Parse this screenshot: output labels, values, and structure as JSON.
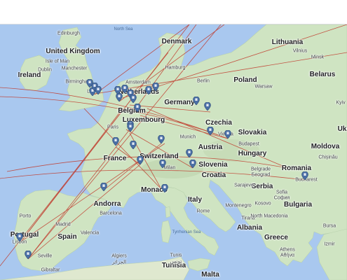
{
  "map": {
    "colors": {
      "sea": "#a9c8ef",
      "land": "#cfe4c2",
      "route": "#c0392b",
      "marker": "#4a6fa5"
    },
    "countries": [
      {
        "name": "United Kingdom",
        "id": "uk"
      },
      {
        "name": "Ireland",
        "id": "ireland"
      },
      {
        "name": "Denmark",
        "id": "denmark"
      },
      {
        "name": "Lithuania",
        "id": "lithuania"
      },
      {
        "name": "Belarus",
        "id": "belarus"
      },
      {
        "name": "Netherlands",
        "id": "netherlands"
      },
      {
        "name": "Belgium",
        "id": "belgium"
      },
      {
        "name": "Luxembourg",
        "id": "luxembourg"
      },
      {
        "name": "Germany",
        "id": "germany"
      },
      {
        "name": "Poland",
        "id": "poland"
      },
      {
        "name": "Czechia",
        "id": "czechia"
      },
      {
        "name": "Slovakia",
        "id": "slovakia"
      },
      {
        "name": "Austria",
        "id": "austria"
      },
      {
        "name": "Hungary",
        "id": "hungary"
      },
      {
        "name": "Moldova",
        "id": "moldova"
      },
      {
        "name": "France",
        "id": "france"
      },
      {
        "name": "Switzerland",
        "id": "switzerland"
      },
      {
        "name": "Slovenia",
        "id": "slovenia"
      },
      {
        "name": "Croatia",
        "id": "croatia"
      },
      {
        "name": "Romania",
        "id": "romania"
      },
      {
        "name": "Serbia",
        "id": "serbia"
      },
      {
        "name": "Bulgaria",
        "id": "bulgaria"
      },
      {
        "name": "Italy",
        "id": "italy"
      },
      {
        "name": "Monaco",
        "id": "monaco"
      },
      {
        "name": "Andorra",
        "id": "andorra"
      },
      {
        "name": "Spain",
        "id": "spain"
      },
      {
        "name": "Portugal",
        "id": "portugal"
      },
      {
        "name": "Greece",
        "id": "greece"
      },
      {
        "name": "Albania",
        "id": "albania"
      },
      {
        "name": "Tunisia",
        "id": "tunisia"
      },
      {
        "name": "Malta",
        "id": "malta"
      },
      {
        "name": "Ukr",
        "id": "ukr"
      }
    ],
    "cities": [
      {
        "name": "Edinburgh",
        "id": "edinburgh"
      },
      {
        "name": "Dublin",
        "id": "dublin"
      },
      {
        "name": "Isle of Man",
        "id": "isle-of-man"
      },
      {
        "name": "Manchester",
        "id": "manchester"
      },
      {
        "name": "Birmingham",
        "id": "birmingham"
      },
      {
        "name": "Lo",
        "id": "london"
      },
      {
        "name": "Amsterdam",
        "id": "amsterdam"
      },
      {
        "name": "Hamburg",
        "id": "hamburg"
      },
      {
        "name": "Berlin",
        "id": "berlin"
      },
      {
        "name": "Vilnius",
        "id": "vilnius"
      },
      {
        "name": "Minsk",
        "id": "minsk"
      },
      {
        "name": "Warsaw",
        "id": "warsaw"
      },
      {
        "name": "Kyiv",
        "id": "kyiv"
      },
      {
        "name": "Paris",
        "id": "paris"
      },
      {
        "name": "Munich",
        "id": "munich"
      },
      {
        "name": "Vienna",
        "id": "vienna"
      },
      {
        "name": "Budapest",
        "id": "budapest"
      },
      {
        "name": "Chișinău",
        "id": "chisinau"
      },
      {
        "name": "Milan",
        "id": "milan"
      },
      {
        "name": "Belgrade",
        "id": "belgrade"
      },
      {
        "name": "Бeograd",
        "id": "beograd"
      },
      {
        "name": "Sarajevo",
        "id": "sarajevo"
      },
      {
        "name": "Bucharest",
        "id": "bucharest"
      },
      {
        "name": "Kosovo",
        "id": "kosovo"
      },
      {
        "name": "Sofia",
        "id": "sofia"
      },
      {
        "name": "София",
        "id": "sofia-cyr"
      },
      {
        "name": "Montenegro",
        "id": "montenegro"
      },
      {
        "name": "Rome",
        "id": "rome"
      },
      {
        "name": "Tirana",
        "id": "tirana"
      },
      {
        "name": "North Macedonia",
        "id": "north-macedonia"
      },
      {
        "name": "Bursa",
        "id": "bursa"
      },
      {
        "name": "Izmir",
        "id": "izmir"
      },
      {
        "name": "Porto",
        "id": "porto"
      },
      {
        "name": "Madrid",
        "id": "madrid"
      },
      {
        "name": "Barcelona",
        "id": "barcelona"
      },
      {
        "name": "Valencia",
        "id": "valencia"
      },
      {
        "name": "Lisbon",
        "id": "lisbon"
      },
      {
        "name": "Seville",
        "id": "seville"
      },
      {
        "name": "Gibraltar",
        "id": "gibraltar"
      },
      {
        "name": "Algiers",
        "id": "algiers"
      },
      {
        "name": "الجزائر",
        "id": "algiers-ar"
      },
      {
        "name": "Tunis",
        "id": "tunis"
      },
      {
        "name": "تونس",
        "id": "tunis-ar"
      },
      {
        "name": "Athens",
        "id": "athens"
      },
      {
        "name": "Αθήνα",
        "id": "athens-gr"
      }
    ],
    "seas": [
      {
        "name": "North Sea",
        "id": "north-sea"
      },
      {
        "name": "Tyrrhenian Sea",
        "id": "tyrrhenian-sea"
      }
    ]
  }
}
